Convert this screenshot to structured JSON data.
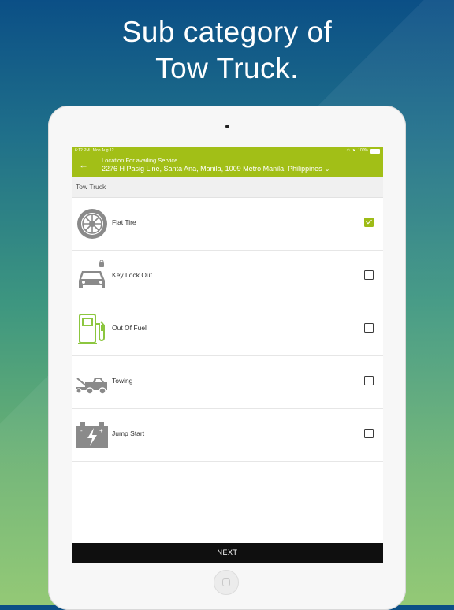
{
  "headline": {
    "line1": "Sub category of",
    "line2": "Tow Truck."
  },
  "status": {
    "time": "6:12 PM",
    "date": "Mon Aug 12",
    "battery": "100%"
  },
  "appbar": {
    "location_title": "Location For availing Service",
    "address": "2276 H Pasig Line,  Santa Ana,  Manila,  1009 Metro Manila,  Philippines"
  },
  "section": {
    "label": "Tow Truck"
  },
  "items": [
    {
      "label": "Flat Tire",
      "icon": "tire-icon",
      "checked": true
    },
    {
      "label": "Key Lock Out",
      "icon": "car-lock-icon",
      "checked": false
    },
    {
      "label": "Out Of Fuel",
      "icon": "fuel-pump-icon",
      "checked": false
    },
    {
      "label": "Towing",
      "icon": "tow-truck-icon",
      "checked": false
    },
    {
      "label": "Jump Start",
      "icon": "battery-icon",
      "checked": false
    }
  ],
  "footer": {
    "next_label": "NEXT"
  },
  "colors": {
    "accent": "#a2bf17",
    "checked": "#9dbb16",
    "footer": "#0f0f0f"
  }
}
